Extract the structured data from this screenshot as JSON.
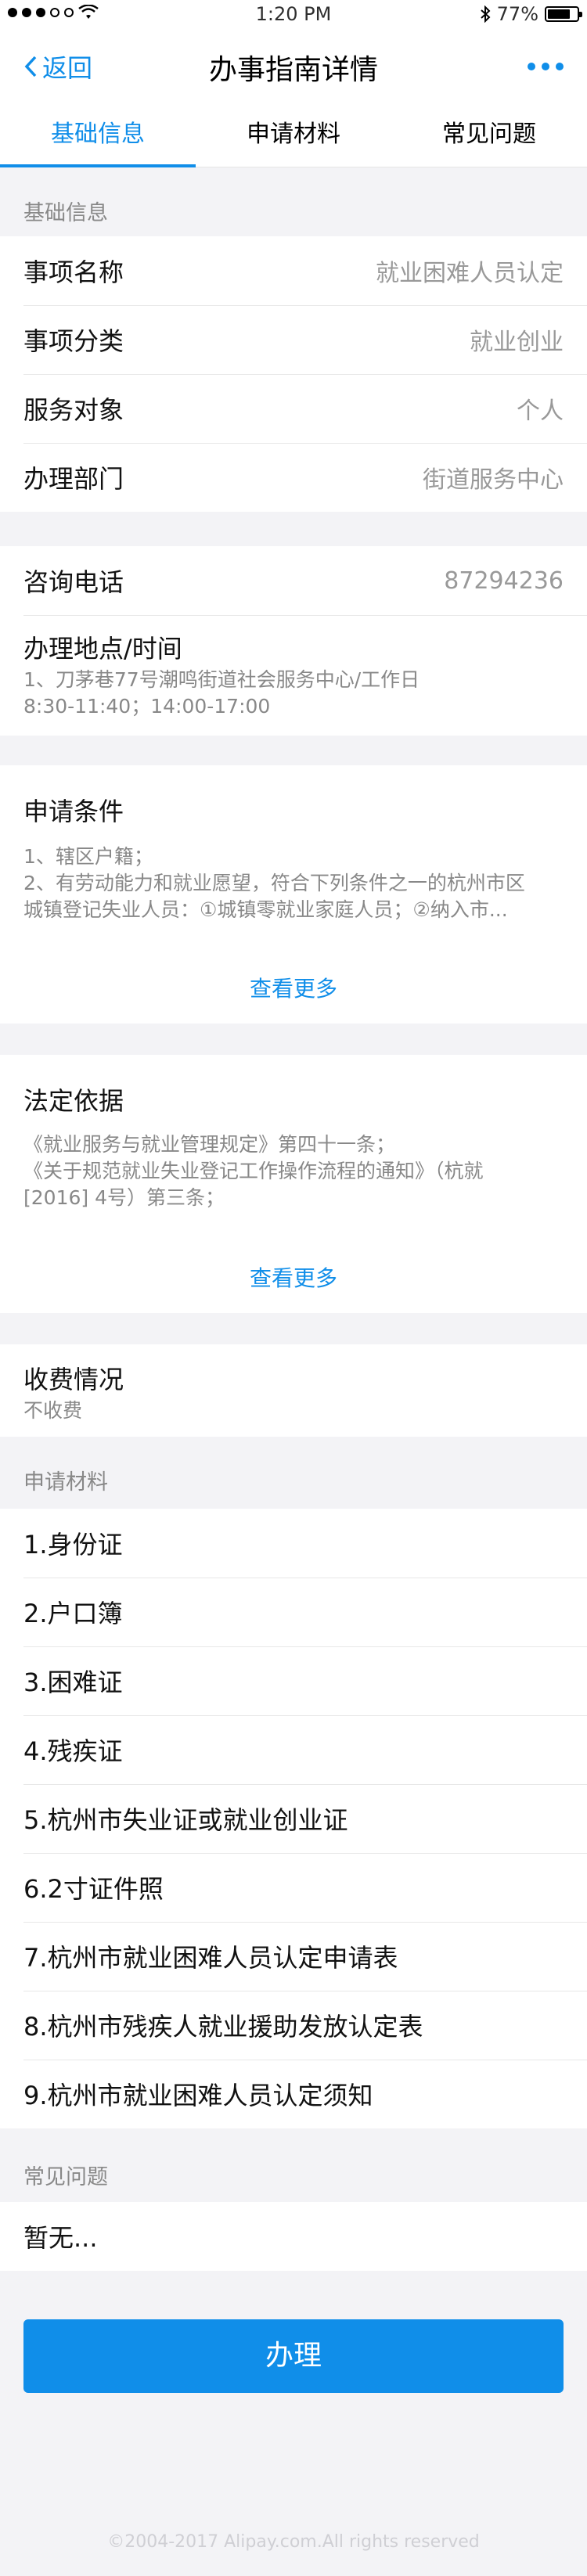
{
  "status_bar": {
    "time": "1:20 PM",
    "battery": "77%",
    "battery_level": 0.77
  },
  "nav": {
    "back_label": "返回",
    "title": "办事指南详情",
    "more_icon": "ellipsis-icon"
  },
  "tabs": [
    {
      "label": "基础信息",
      "active": true
    },
    {
      "label": "申请材料",
      "active": false
    },
    {
      "label": "常见问题",
      "active": false
    }
  ],
  "basic": {
    "header": "基础信息",
    "rows": [
      {
        "label": "事项名称",
        "value": "就业困难人员认定"
      },
      {
        "label": "事项分类",
        "value": "就业创业"
      },
      {
        "label": "服务对象",
        "value": "个人"
      },
      {
        "label": "办理部门",
        "value": "街道服务中心"
      }
    ]
  },
  "contact": {
    "phone_label": "咨询电话",
    "phone_value": "87294236",
    "location_label": "办理地点/时间",
    "location_line1": "1、刀茅巷77号潮鸣街道社会服务中心/工作日",
    "location_line2": "8:30-11:40；14:00-17:00"
  },
  "conditions": {
    "title": "申请条件",
    "lines": [
      "1、辖区户籍；",
      "2、有劳动能力和就业愿望，符合下列条件之一的杭州市区",
      "城镇登记失业人员：①城镇零就业家庭人员；②纳入市..."
    ],
    "more_label": "查看更多"
  },
  "legal": {
    "title": "法定依据",
    "lines": [
      "《就业服务与就业管理规定》第四十一条；",
      "《关于规范就业失业登记工作操作流程的通知》（杭就",
      "[2016] 4号）第三条；"
    ],
    "more_label": "查看更多"
  },
  "fees": {
    "title": "收费情况",
    "value": "不收费"
  },
  "materials": {
    "header": "申请材料",
    "items": [
      "1.身份证",
      "2.户口簿",
      "3.困难证",
      "4.残疾证",
      "5.杭州市失业证或就业创业证",
      "6.2寸证件照",
      "7.杭州市就业困难人员认定申请表",
      "8.杭州市残疾人就业援助发放认定表",
      "9.杭州市就业困难人员认定须知"
    ]
  },
  "faq": {
    "header": "常见问题",
    "value": "暂无..."
  },
  "action": {
    "label": "办理"
  },
  "footer": {
    "copyright": "©2004-2017 Alipay.com.All rights reserved"
  },
  "colors": {
    "accent": "#108ee9",
    "background": "#f3f3f6"
  }
}
